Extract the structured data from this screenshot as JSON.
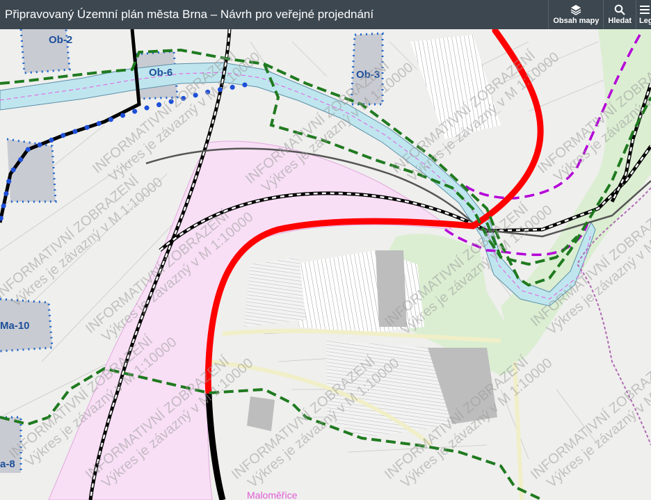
{
  "header": {
    "title": "Připravovaný Územní plán města Brna – Návrh pro veřejné projednání",
    "tools": [
      {
        "label": "Obsah mapy",
        "icon": "layers-icon"
      },
      {
        "label": "Hledat",
        "icon": "search-icon"
      },
      {
        "label": "Legenda",
        "icon": "legend-icon"
      }
    ]
  },
  "map": {
    "area_labels": [
      "Ob-2",
      "Ob-6",
      "Ob-3",
      "Ma-10",
      "a-8"
    ],
    "place_label": "Maloměřice",
    "watermark_line1": "INFORMATIVNÍ ZOBRAZENÍ",
    "watermark_line2": "Výkres je závazný v M 1:10000",
    "colors": {
      "header_bg": "#3c4750",
      "highway": "#ff0000",
      "rail": "#000000",
      "green_boundary": "#1f7a1f",
      "river": "#bfe6ee",
      "industrial_zone": "#f8dff5",
      "greenery": "#dbeed2",
      "purple_boundary": "#b400d8"
    }
  }
}
